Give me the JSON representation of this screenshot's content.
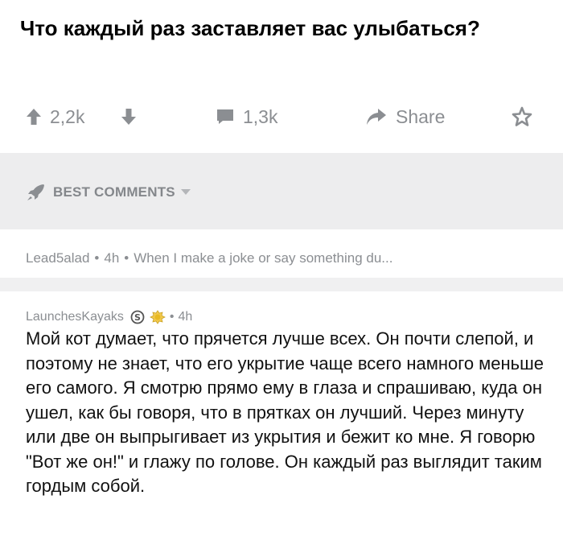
{
  "post": {
    "title": "Что каждый раз заставляет вас улыбаться?"
  },
  "actions": {
    "upvote_count": "2,2k",
    "comment_count": "1,3k",
    "share_label": "Share",
    "icons": {
      "upvote": "arrow-up-icon",
      "downvote": "arrow-down-icon",
      "comment": "comment-bubble-icon",
      "share": "share-arrow-icon",
      "save": "star-icon"
    }
  },
  "sort": {
    "label": "BEST COMMENTS",
    "icon": "rocket-icon"
  },
  "collapsed_comment": {
    "author": "Lead5alad",
    "age": "4h",
    "preview": "When I make a joke or say something du..."
  },
  "comment": {
    "author": "LaunchesKayaks",
    "age": "4h",
    "badges": [
      "silver-award-icon",
      "gold-award-icon"
    ],
    "body": "Мой кот думает, что прячется лучше всех. Он почти слепой, и поэтому не знает, что его укрытие чаще всего намного меньше его самого. Я смотрю прямо ему в глаза и спрашиваю, куда он ушел, как бы говоря, что в прятках он лучший. Через минуту или две он выпрыгивает из укрытия и бежит ко мне. Я говорю \"Вот же он!\" и глажу по голове. Он каждый раз выглядит таким гордым собой."
  },
  "colors": {
    "muted_text": "#8b8e92",
    "band": "#ededee",
    "title": "#000000"
  }
}
